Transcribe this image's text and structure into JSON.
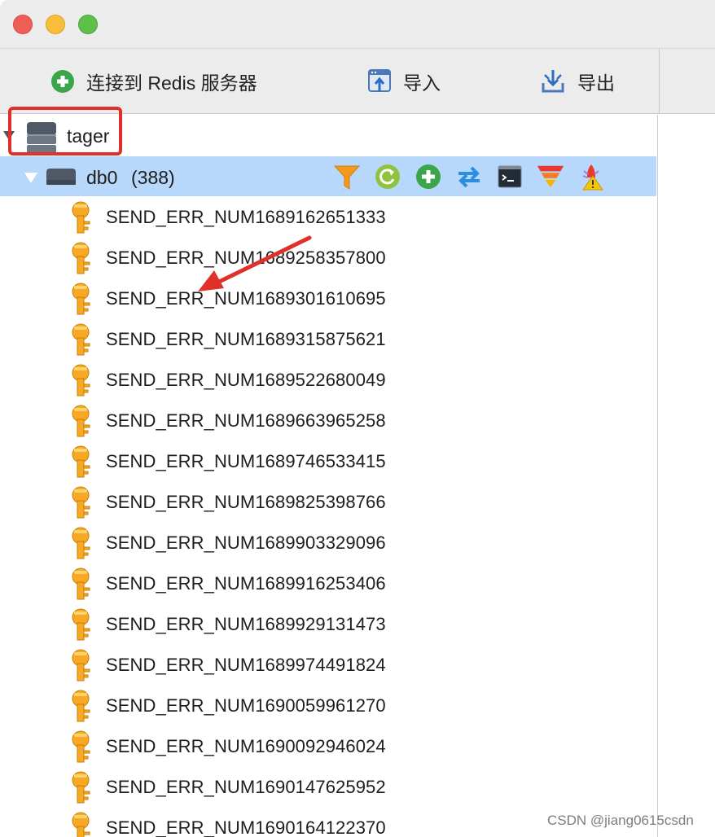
{
  "window": {
    "controls": [
      "close",
      "minimize",
      "maximize"
    ]
  },
  "toolbar": {
    "connect_label": "连接到 Redis 服务器",
    "import_label": "导入",
    "export_label": "导出"
  },
  "tree": {
    "server": {
      "name": "tager",
      "expanded": true,
      "icon": "server-stack-icon"
    },
    "database": {
      "name": "db0",
      "count": "(388)",
      "expanded": true,
      "actions": [
        "filter-icon",
        "reload-icon",
        "add-key-icon",
        "move-icon",
        "console-icon",
        "flush-icon",
        "analyze-icon"
      ]
    },
    "keys": [
      "SEND_ERR_NUM1689162651333",
      "SEND_ERR_NUM1689258357800",
      "SEND_ERR_NUM1689301610695",
      "SEND_ERR_NUM1689315875621",
      "SEND_ERR_NUM1689522680049",
      "SEND_ERR_NUM1689663965258",
      "SEND_ERR_NUM1689746533415",
      "SEND_ERR_NUM1689825398766",
      "SEND_ERR_NUM1689903329096",
      "SEND_ERR_NUM1689916253406",
      "SEND_ERR_NUM1689929131473",
      "SEND_ERR_NUM1689974491824",
      "SEND_ERR_NUM1690059961270",
      "SEND_ERR_NUM1690092946024",
      "SEND_ERR_NUM1690147625952",
      "SEND_ERR_NUM1690164122370"
    ]
  },
  "annotation": {
    "color": "#e0302a"
  },
  "watermark": "CSDN @jiang0615csdn",
  "colors": {
    "selection": "#b7d7fb",
    "key": "#f9a825",
    "toolbar": "#ececec"
  }
}
